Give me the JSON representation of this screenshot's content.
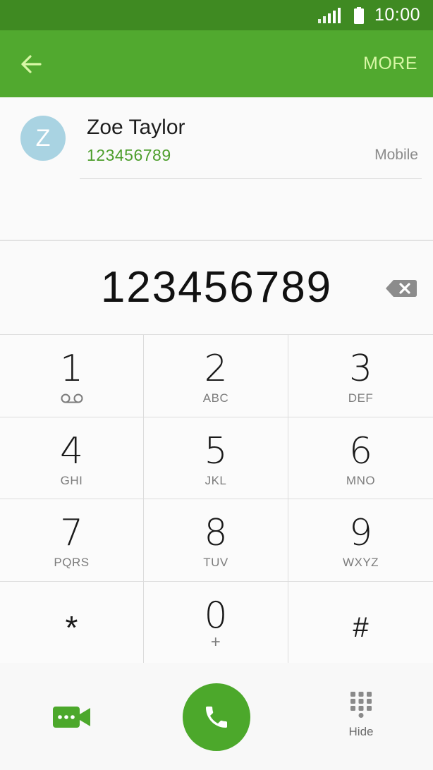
{
  "status_bar": {
    "time": "10:00",
    "signal_icon": "signal-icon",
    "battery_icon": "battery-icon"
  },
  "app_bar": {
    "back_icon": "arrow-left-icon",
    "more_label": "MORE"
  },
  "contact": {
    "avatar_initial": "Z",
    "name": "Zoe Taylor",
    "number": "123456789",
    "type": "Mobile"
  },
  "dialer": {
    "dialed_number": "123456789",
    "backspace_icon": "backspace-icon"
  },
  "keypad": {
    "keys": [
      {
        "digit": "1",
        "letters": "",
        "icon": "voicemail-icon"
      },
      {
        "digit": "2",
        "letters": "ABC"
      },
      {
        "digit": "3",
        "letters": "DEF"
      },
      {
        "digit": "4",
        "letters": "GHI"
      },
      {
        "digit": "5",
        "letters": "JKL"
      },
      {
        "digit": "6",
        "letters": "MNO"
      },
      {
        "digit": "7",
        "letters": "PQRS"
      },
      {
        "digit": "8",
        "letters": "TUV"
      },
      {
        "digit": "9",
        "letters": "WXYZ"
      },
      {
        "digit": "*",
        "letters": ""
      },
      {
        "digit": "0",
        "letters": "+"
      },
      {
        "digit": "#",
        "letters": ""
      }
    ]
  },
  "bottom_bar": {
    "video_call_icon": "video-call-icon",
    "call_icon": "phone-icon",
    "hide_icon": "dialpad-icon",
    "hide_label": "Hide"
  },
  "colors": {
    "status_bar": "#3f8a22",
    "app_bar": "#51a92f",
    "accent": "#4ca82b",
    "more_text": "#d8f7a6",
    "contact_number": "#4d9e2c",
    "avatar": "#a9d3e2"
  }
}
